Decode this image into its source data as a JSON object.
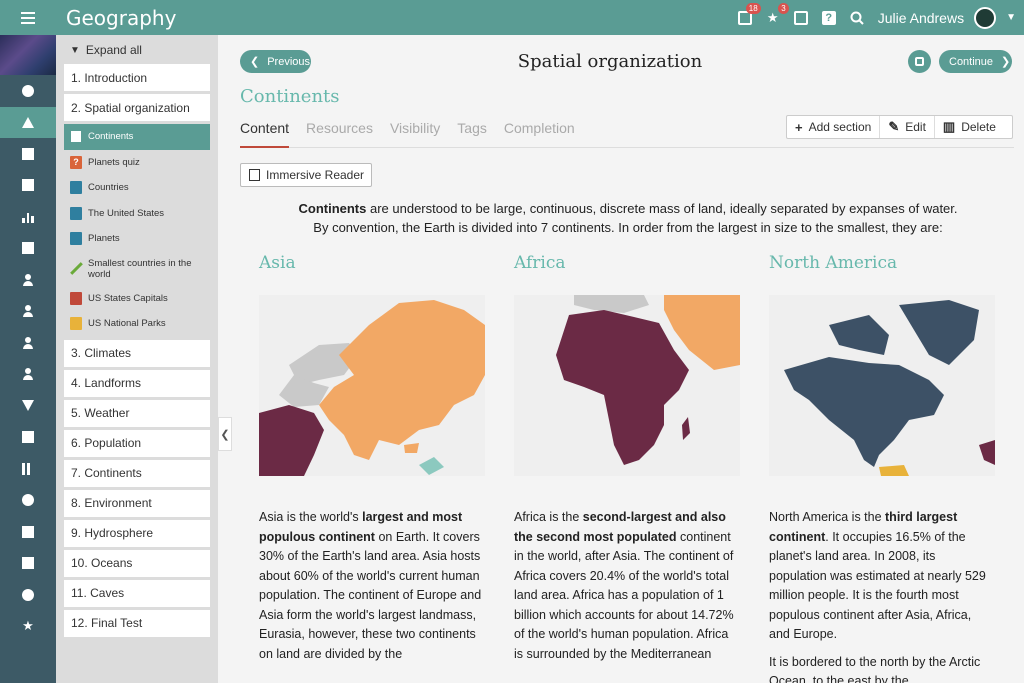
{
  "app": {
    "title": "Geography",
    "user_name": "Julie Andrews",
    "badge_messages": "18",
    "badge_notifications": "3"
  },
  "colors": {
    "accent": "#5a9c94",
    "heading": "#67b8ac",
    "rail": "#3d5a66",
    "asia": "#f2a865",
    "africa": "#6b2a45",
    "north_america": "#3d5166"
  },
  "outline": {
    "expand_label": "Expand all",
    "sections_before": [
      {
        "label": "1. Introduction"
      },
      {
        "label": "2. Spatial organization"
      }
    ],
    "pages": [
      {
        "label": "Continents",
        "icon": "document-icon"
      },
      {
        "label": "Planets quiz",
        "icon": "quiz-icon"
      },
      {
        "label": "Countries",
        "icon": "book-icon"
      },
      {
        "label": "The United States",
        "icon": "book-icon"
      },
      {
        "label": "Planets",
        "icon": "book-icon"
      },
      {
        "label": "Smallest countries in the world",
        "icon": "pencil-icon"
      },
      {
        "label": "US States Capitals",
        "icon": "bag-icon"
      },
      {
        "label": "US National Parks",
        "icon": "box-icon"
      }
    ],
    "sections_after": [
      {
        "label": "3. Climates"
      },
      {
        "label": "4. Landforms"
      },
      {
        "label": "5. Weather"
      },
      {
        "label": "6. Population"
      },
      {
        "label": "7. Continents"
      },
      {
        "label": "8. Environment"
      },
      {
        "label": "9. Hydrosphere"
      },
      {
        "label": "10. Oceans"
      },
      {
        "label": "11. Caves"
      },
      {
        "label": "12. Final Test"
      }
    ]
  },
  "main": {
    "prev_label": "Previous",
    "continue_label": "Continue",
    "page_title": "Spatial organization",
    "section_title": "Continents",
    "tabs": [
      "Content",
      "Resources",
      "Visibility",
      "Tags",
      "Completion"
    ],
    "actions": {
      "add": "Add section",
      "edit": "Edit",
      "delete": "Delete"
    },
    "reader_label": "Immersive Reader",
    "intro": {
      "bold": "Continents",
      "rest1": " are understood to be large, continuous, discrete mass of land, ideally separated by expanses of water.",
      "line2": "By convention, the Earth is divided into 7 continents. In order from the largest in size to the smallest, they are:"
    },
    "columns": [
      {
        "title": "Asia",
        "p1_a": "Asia is the world's ",
        "p1_b": "largest and most populous continent",
        "p1_c": " on Earth. It covers 30% of the Earth's land area. Asia hosts about 60% of the world's current human population. The continent of Europe and Asia form the world's largest landmass, Eurasia, however, these two continents on land are divided by the"
      },
      {
        "title": "Africa",
        "p1_a": "Africa is the ",
        "p1_b": "second-largest and also the second most populated",
        "p1_c": " continent in the world, after Asia. The continent of Africa covers 20.4% of the world's total land area. Africa has a population of 1 billion which accounts for about 14.72% of the world's human population. Africa is surrounded by the Mediterranean"
      },
      {
        "title": "North America",
        "p1_a": "North America is the ",
        "p1_b": "third largest continent",
        "p1_c": ". It occupies 16.5% of the planet's land area. In 2008, its population was estimated at nearly 529 million people. It is the fourth most populous continent after Asia, Africa, and Europe.",
        "p2": "It is bordered to the north by the Arctic Ocean, to the east by the"
      }
    ]
  }
}
